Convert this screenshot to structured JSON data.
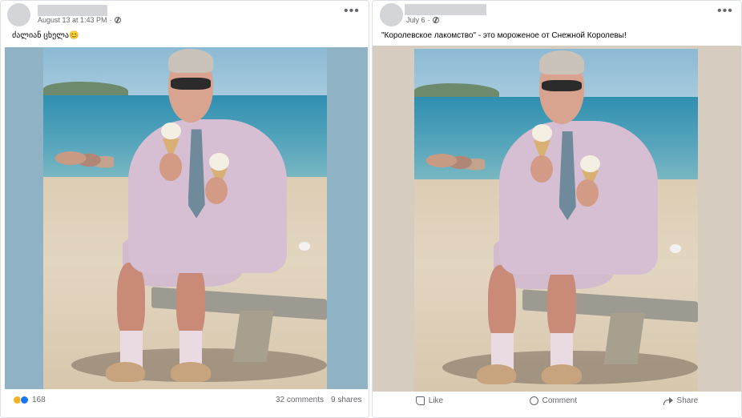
{
  "posts": [
    {
      "timestamp": "August 13 at 1:43 PM",
      "caption": "ძალიან ცხელა😊",
      "reaction_count": "168",
      "comments": "32 comments",
      "shares": "9 shares",
      "reactions": [
        "haha-icon",
        "like-icon"
      ]
    },
    {
      "timestamp": "July 6",
      "caption": "\"Королевское лакомство\" - это мороженое от Снежной Королевы!",
      "actions": {
        "like": "Like",
        "comment": "Comment",
        "share": "Share"
      }
    }
  ],
  "colors": {
    "left_photo_border": "#8fb3c4",
    "right_photo_border": "#d7ccc0",
    "meta_text": "#65676b",
    "placeholder": "#d3d5d9"
  },
  "more_glyph": "•••"
}
